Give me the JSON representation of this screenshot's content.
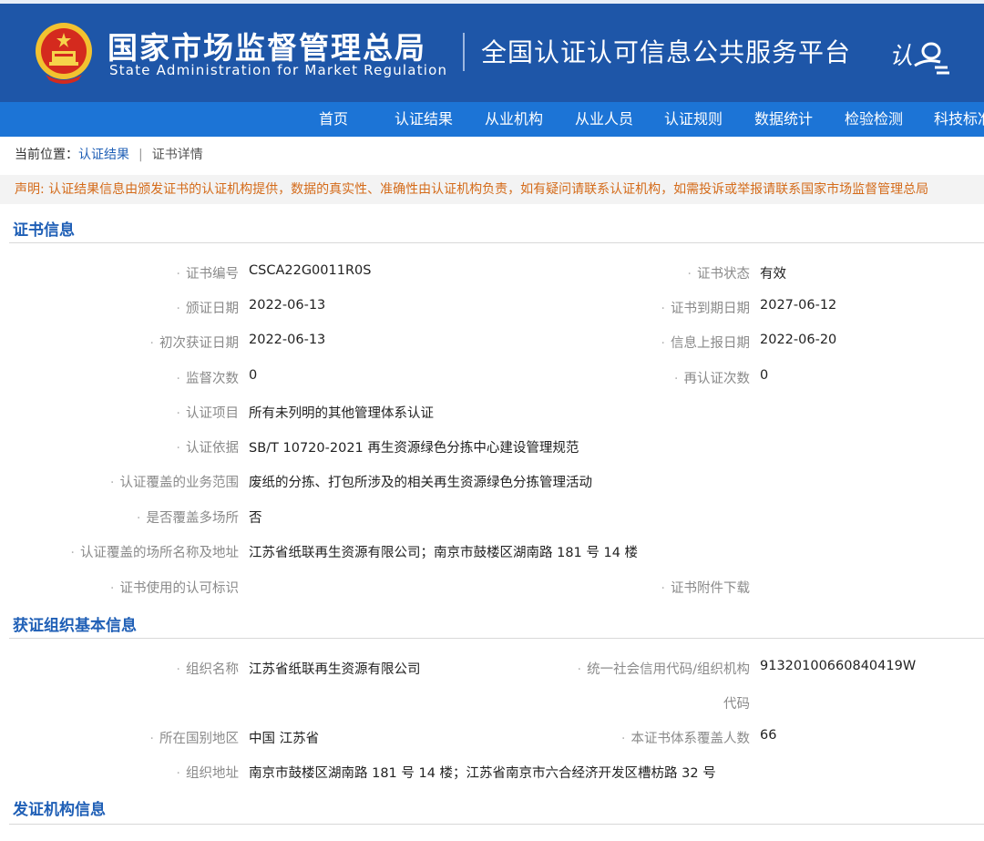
{
  "header": {
    "agency_cn": "国家市场监督管理总局",
    "agency_en": "State Administration for Market Regulation",
    "platform": "全国认证认可信息公共服务平台",
    "logo_text": "认",
    "colors": {
      "header_bg": "#1e56a8",
      "nav_bg": "#1c74d6",
      "accent": "#1f5fb6",
      "notice": "#d46b1a"
    }
  },
  "nav": {
    "items": [
      "首页",
      "认证结果",
      "从业机构",
      "从业人员",
      "认证规则",
      "数据统计",
      "检验检测",
      "科技标准"
    ]
  },
  "breadcrumb": {
    "prefix": "当前位置：",
    "link": "认证结果",
    "sep": "|",
    "current": "证书详情"
  },
  "notice": "声明: 认证结果信息由颁发证书的认证机构提供，数据的真实性、准确性由认证机构负责，如有疑问请联系认证机构，如需投诉或举报请联系国家市场监督管理总局",
  "sections": {
    "cert_title": "证书信息",
    "org_title": "获证组织基本信息",
    "issuer_title": "发证机构信息"
  },
  "cert": {
    "cert_no_label": "证书编号",
    "cert_no": "CSCA22G0011R0S",
    "status_label": "证书状态",
    "status": "有效",
    "issue_date_label": "颁证日期",
    "issue_date": "2022-06-13",
    "expire_label": "证书到期日期",
    "expire": "2027-06-12",
    "first_date_label": "初次获证日期",
    "first_date": "2022-06-13",
    "report_date_label": "信息上报日期",
    "report_date": "2022-06-20",
    "supervise_label": "监督次数",
    "supervise": "0",
    "recert_label": "再认证次数",
    "recert": "0",
    "project_label": "认证项目",
    "project": "所有未列明的其他管理体系认证",
    "basis_label": "认证依据",
    "basis": "SB/T 10720-2021 再生资源绿色分拣中心建设管理规范",
    "scope_label": "认证覆盖的业务范围",
    "scope": "废纸的分拣、打包所涉及的相关再生资源绿色分拣管理活动",
    "multi_label": "是否覆盖多场所",
    "multi": "否",
    "site_label": "认证覆盖的场所名称及地址",
    "site": "江苏省纸联再生资源有限公司；南京市鼓楼区湖南路 181 号 14 楼",
    "accred_label": "证书使用的认可标识",
    "attach_label": "证书附件下载"
  },
  "org": {
    "name_label": "组织名称",
    "name": "江苏省纸联再生资源有限公司",
    "credit_label_1": "统一社会信用代码/组织机构",
    "credit_label_2": "代码",
    "credit": "91320100660840419W",
    "region_label": "所在国别地区",
    "region": "中国 江苏省",
    "people_label": "本证书体系覆盖人数",
    "people": "66",
    "address_label": "组织地址",
    "address": "南京市鼓楼区湖南路 181 号 14 楼；江苏省南京市六合经济开发区槽枋路 32 号"
  }
}
